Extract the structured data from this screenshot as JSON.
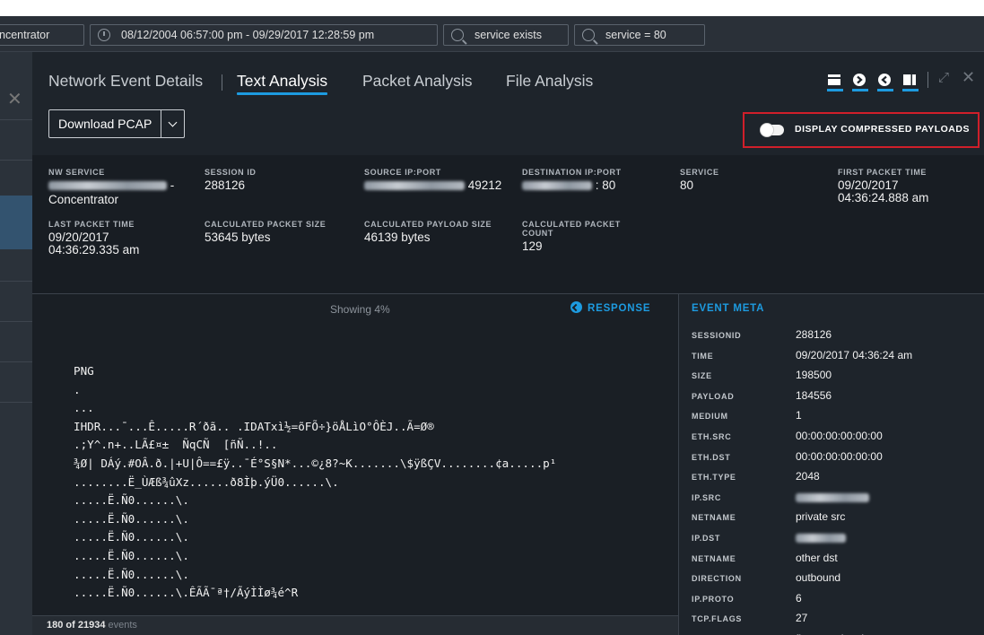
{
  "filter_bar": {
    "service_source": "ncentrator",
    "time_range": "08/12/2004 06:57:00 pm - 09/29/2017 12:28:59 pm",
    "query1": "service exists",
    "query2": "service = 80"
  },
  "tabs": [
    {
      "label": "Network Event Details"
    },
    {
      "label": "Text Analysis"
    },
    {
      "label": "Packet Analysis"
    },
    {
      "label": "File Analysis"
    }
  ],
  "toolbar": {
    "download_label": "Download PCAP",
    "toggle_label": "DISPLAY COMPRESSED PAYLOADS",
    "toggle_on": false,
    "icons": [
      "request-and-response-icon",
      "request-icon",
      "response-icon",
      "side-by-side-icon",
      "expand-icon",
      "close-icon"
    ]
  },
  "session_meta": {
    "nw_service": {
      "label": "NW SERVICE",
      "suffix": "-",
      "value": "Concentrator"
    },
    "session_id": {
      "label": "SESSION ID",
      "value": "288126"
    },
    "source_ip_port": {
      "label": "SOURCE IP:PORT",
      "port": "49212"
    },
    "destination_ip_port": {
      "label": "DESTINATION IP:PORT",
      "port": ": 80"
    },
    "service": {
      "label": "SERVICE",
      "value": "80"
    },
    "first_packet_time": {
      "label": "FIRST PACKET TIME",
      "date": "09/20/2017",
      "time": "04:36:24.888 am"
    },
    "last_packet_time": {
      "label": "LAST PACKET TIME",
      "date": "09/20/2017",
      "time": "04:36:29.335 am"
    },
    "calculated_packet_size": {
      "label": "CALCULATED PACKET SIZE",
      "value": "53645 bytes"
    },
    "calculated_payload_size": {
      "label": "CALCULATED PAYLOAD SIZE",
      "value": "46139 bytes"
    },
    "calculated_packet_count": {
      "label": "CALCULATED PACKET COUNT",
      "value": "129"
    }
  },
  "text_analysis": {
    "showing": "Showing 4%",
    "direction_label": "RESPONSE",
    "payload_lines": [
      "PNG",
      ".",
      "...",
      "IHDR...¯...Ê.....R´ðã.. .IDATxì½=õFÕ÷}öÅLìO°ÔÈJ..Ã=Ø®",
      ".;Y^.n+..LÃ£¤±  ÑqCÑ  [ñÑ..!..",
      "¾Ø| DÁý.#OÂ.ð.|+U|Ô==£ÿ..¯É°S§N*...©¿8?~K.......\\$ÿßÇV........¢a.....p¹",
      "........Ë_ÙÆß¾ûXz......ð8Ìþ.ýÜ0......\\.",
      ".....Ë.Ñ0......\\.",
      ".....Ë.Ñ0......\\.",
      ".....Ë.Ñ0......\\.",
      ".....Ë.Ñ0......\\.",
      ".....Ë.Ñ0......\\.",
      ".....Ë.Ñ0......\\.ÊÃÃ¯ª†/ÃýÌÌø¾é^R"
    ],
    "pager_count": "180 of 21934",
    "pager_unit": "events"
  },
  "event_meta": {
    "title": "EVENT META",
    "rows": [
      {
        "key": "SESSIONID",
        "value": "288126"
      },
      {
        "key": "TIME",
        "value": "09/20/2017 04:36:24 am"
      },
      {
        "key": "SIZE",
        "value": "198500"
      },
      {
        "key": "PAYLOAD",
        "value": "184556"
      },
      {
        "key": "MEDIUM",
        "value": "1"
      },
      {
        "key": "ETH.SRC",
        "value": "00:00:00:00:00:00"
      },
      {
        "key": "ETH.DST",
        "value": "00:00:00:00:00:00"
      },
      {
        "key": "ETH.TYPE",
        "value": "2048"
      },
      {
        "key": "IP.SRC",
        "value": ""
      },
      {
        "key": "NETNAME",
        "value": "private src"
      },
      {
        "key": "IP.DST",
        "value": ""
      },
      {
        "key": "NETNAME",
        "value": "other dst"
      },
      {
        "key": "DIRECTION",
        "value": "outbound"
      },
      {
        "key": "IP.PROTO",
        "value": "6"
      },
      {
        "key": "TCP.FLAGS",
        "value": "27"
      },
      {
        "key": "TCP.FLAGS.SEEN",
        "value": "fin syn psh ack"
      }
    ]
  },
  "colors": {
    "accent": "#1d9be0",
    "highlight_border": "#d01f2a",
    "panel_bg": "#1e242b"
  }
}
